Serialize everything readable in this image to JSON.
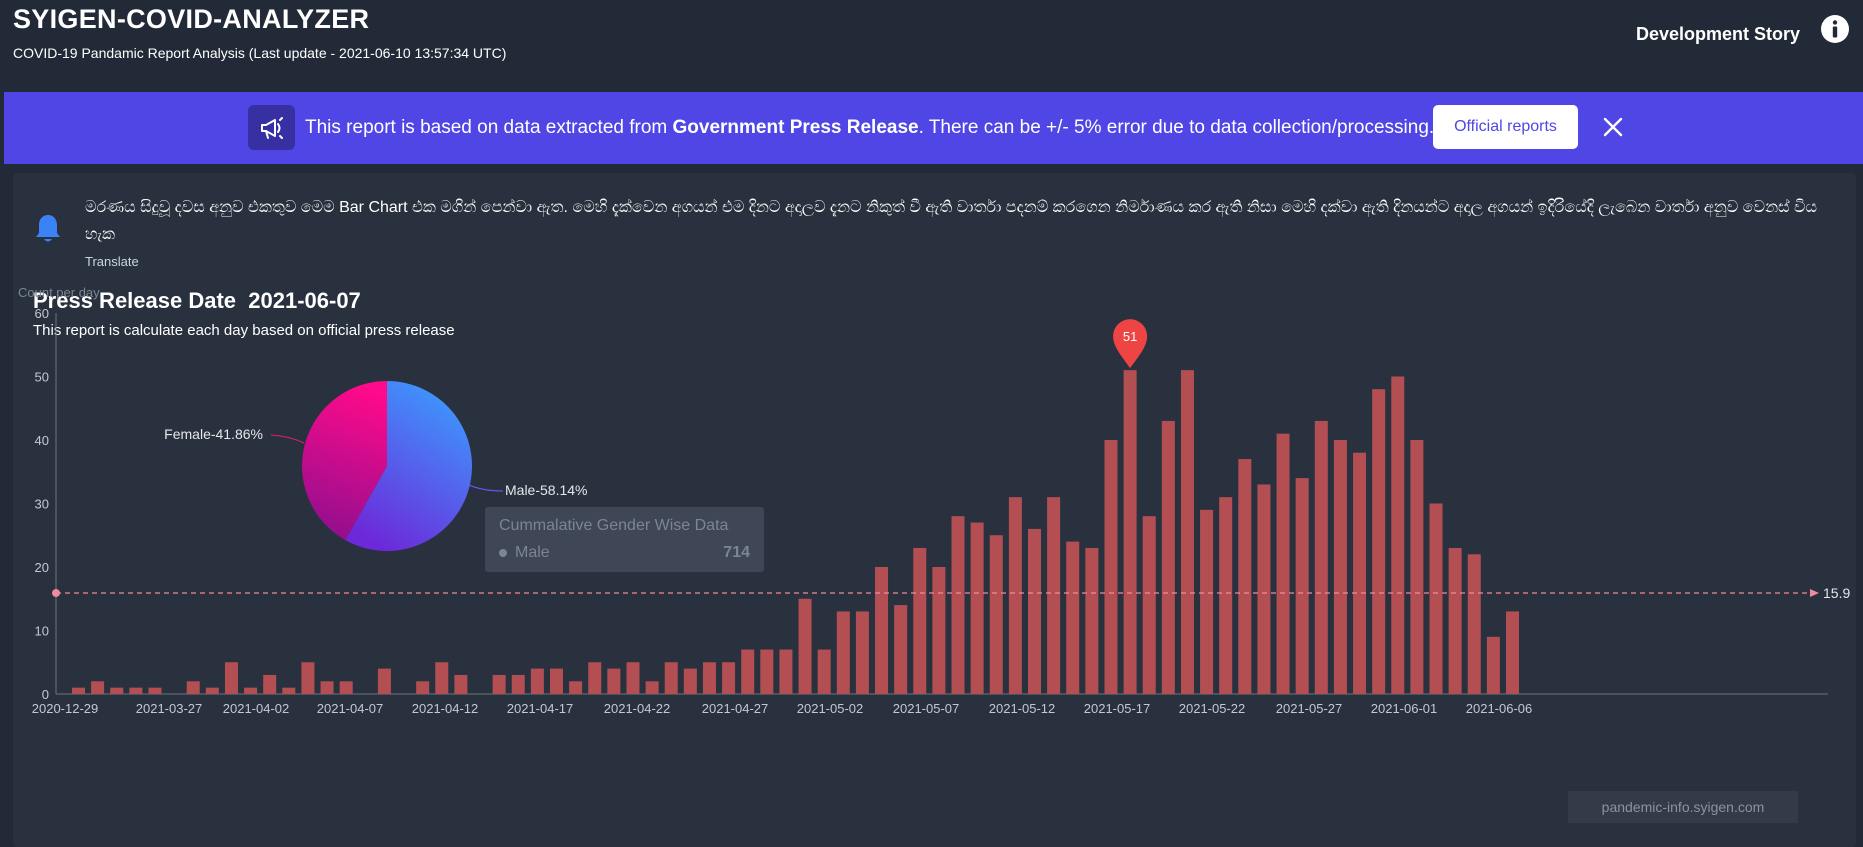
{
  "header": {
    "title": "SYIGEN-COVID-ANALYZER",
    "subtitle": "COVID-19 Pandamic Report Analysis  (Last update - 2021-06-10 13:57:34 UTC)",
    "dev_story": "Development Story",
    "info_icon": "info-circle-icon"
  },
  "banner": {
    "icon": "megaphone-icon",
    "text_before": "This report is based on data extracted from ",
    "text_bold": "Government Press Release",
    "text_after": ". There can be +/- 5% error due to data collection/processing.",
    "button_label": "Official reports",
    "close_icon": "close-icon",
    "background": "#4f46e5"
  },
  "notice": {
    "icon": "bell-icon",
    "text": "මරණය සිදුවූ දවස අනුව එකතුව මෙම Bar Chart එක මගින් පෙන්වා ඇත. මෙහි දැක්වෙන අගයන් එම දිනට අදාලව දැනට නිකුත් වී ඇති වාර්තා පදනම් කරගෙන නිර්මාණය කර ඇති නිසා මෙහි දක්වා ඇති දිනයන්ට අදාල අගයන් ඉදිරියේදි ලැබෙන වාර්තා අනුව වෙනස් විය හැක",
    "translate": "Translate"
  },
  "report": {
    "title": "Press Release Date  2021-06-07",
    "description": "This report is calculate each day based on official press release"
  },
  "chart_data": [
    {
      "type": "bar",
      "ylabel": "Count per day",
      "ylim": [
        0,
        60
      ],
      "yticks": [
        0,
        10,
        20,
        30,
        40,
        50,
        60
      ],
      "bar_color": "#b34f53",
      "values": [
        1,
        2,
        1,
        1,
        1,
        0,
        2,
        1,
        5,
        1,
        3,
        1,
        5,
        2,
        2,
        0,
        4,
        0,
        2,
        5,
        3,
        0,
        3,
        3,
        4,
        4,
        2,
        5,
        4,
        5,
        2,
        5,
        4,
        5,
        5,
        7,
        7,
        7,
        15,
        7,
        13,
        13,
        20,
        14,
        23,
        20,
        28,
        27,
        25,
        31,
        26,
        31,
        24,
        23,
        40,
        51,
        28,
        43,
        51,
        29,
        31,
        37,
        33,
        41,
        34,
        43,
        40,
        38,
        48,
        50,
        40,
        30,
        23,
        22,
        9,
        13
      ],
      "x_tick_labels": [
        "2020-12-29",
        "2021-03-27",
        "2021-04-02",
        "2021-04-07",
        "2021-04-12",
        "2021-04-17",
        "2021-04-22",
        "2021-04-27",
        "2021-05-02",
        "2021-05-07",
        "2021-05-12",
        "2021-05-17",
        "2021-05-22",
        "2021-05-27",
        "2021-06-01",
        "2021-06-06"
      ],
      "average_line": {
        "value": 15.9,
        "label": "15.9",
        "color": "#f08a9c"
      },
      "max_marker": {
        "value": 51,
        "label": "51",
        "index": 55,
        "color": "#ef4444"
      },
      "watermark": "pandemic-info.syigen.com",
      "grid": false
    },
    {
      "type": "pie",
      "slices": [
        {
          "name": "Male",
          "percent": 58.14,
          "label": "Male-58.14%",
          "colors": [
            "#3b9dff",
            "#6d28d9"
          ]
        },
        {
          "name": "Female",
          "percent": 41.86,
          "label": "Female-41.86%",
          "colors": [
            "#ff0a8a",
            "#8e0f8f"
          ]
        }
      ],
      "tooltip": {
        "title": "Cummalative Gender Wise Data",
        "series": "Male",
        "value": "714"
      }
    }
  ]
}
